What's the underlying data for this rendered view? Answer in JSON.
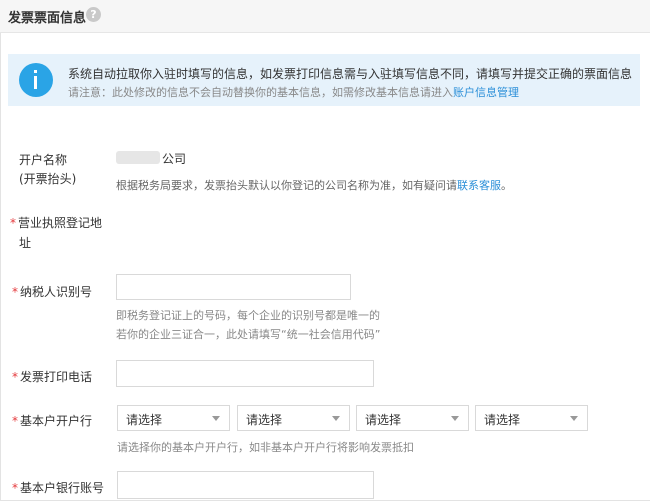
{
  "header": {
    "title": "发票票面信息",
    "help_glyph": "?"
  },
  "notice": {
    "line1": "系统自动拉取你入驻时填写的信息，如发票打印信息需与入驻填写信息不同，请填写并提交正确的票面信息",
    "line2_prefix": "请注意：此处修改的信息不会自动替换你的基本信息，如需修改基本信息请进入",
    "line2_link": "账户信息管理"
  },
  "form": {
    "account_name": {
      "label_line1": "开户名称",
      "label_line2": "(开票抬头)",
      "value_suffix": "公司",
      "hint_prefix": "根据税务局要求，发票抬头默认以你登记的公司名称为准，如有疑问请",
      "hint_link": "联系客服",
      "hint_suffix": "。"
    },
    "business_address": {
      "required": "*",
      "label_line1": "营业执照登记地",
      "label_line2": "址"
    },
    "taxpayer_id": {
      "required": "*",
      "label": "纳税人识别号",
      "hint_line1": "即税务登记证上的号码，每个企业的识别号都是唯一的",
      "hint_line2": "若你的企业三证合一，此处请填写“统一社会信用代码”"
    },
    "invoice_phone": {
      "required": "*",
      "label": "发票打印电话"
    },
    "bank": {
      "required": "*",
      "label": "基本户开户行",
      "select1": "请选择",
      "select2": "请选择",
      "select3": "请选择",
      "select4": "请选择",
      "hint": "请选择你的基本户开户行，如非基本户开户行将影响发票抵扣"
    },
    "bank_account": {
      "required": "*",
      "label": "基本户银行账号"
    }
  }
}
